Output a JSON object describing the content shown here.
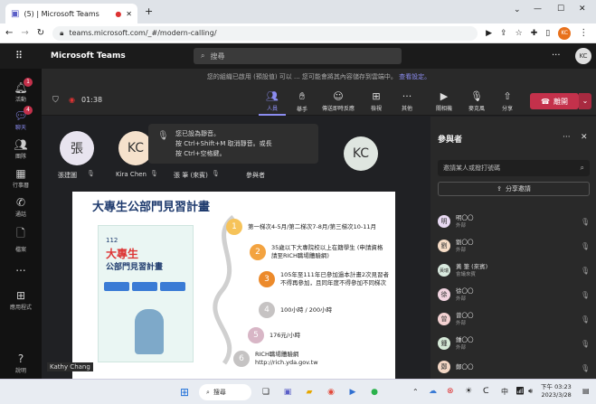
{
  "browser": {
    "tab_count": "(5)",
    "tab_title": "Microsoft Teams",
    "url": "teams.microsoft.com/_#/modern-calling/",
    "profile_initials": "KC"
  },
  "teams": {
    "app_name": "Microsoft Teams",
    "search_placeholder": "搜尋",
    "user_initials": "KC"
  },
  "rail": [
    {
      "label": "活動",
      "icon": "bell-icon",
      "badge": "1"
    },
    {
      "label": "聊天",
      "icon": "chat-icon",
      "badge": "4"
    },
    {
      "label": "團隊",
      "icon": "teams-icon",
      "badge": ""
    },
    {
      "label": "行事曆",
      "icon": "calendar-icon",
      "badge": ""
    },
    {
      "label": "通話",
      "icon": "phone-icon",
      "badge": ""
    },
    {
      "label": "檔案",
      "icon": "file-icon",
      "badge": ""
    },
    {
      "label": "...",
      "icon": "more-icon",
      "badge": ""
    },
    {
      "label": "應用程式",
      "icon": "apps-icon",
      "badge": ""
    },
    {
      "label": "說明",
      "icon": "help-icon",
      "badge": ""
    }
  ],
  "meeting": {
    "notice": "您的組織已啟用 (預設值) 可以 ... 您可能會將其內容儲存到雲端中。",
    "notice_link": "查看設定。",
    "timer": "01:38",
    "controls": [
      {
        "label": "人員",
        "icon": "people-icon"
      },
      {
        "label": "舉手",
        "icon": "hand-icon"
      },
      {
        "label": "傳送即時反應",
        "icon": "emoji-icon"
      },
      {
        "label": "檢視",
        "icon": "view-icon"
      },
      {
        "label": "其他",
        "icon": "more-icon"
      },
      {
        "label": "關相機",
        "icon": "camera-icon"
      },
      {
        "label": "麥克風",
        "icon": "mic-off-icon"
      },
      {
        "label": "分享",
        "icon": "share-icon"
      }
    ],
    "leave_label": "離開"
  },
  "participants_stage": [
    {
      "initials": "張",
      "name": "張建圖",
      "color": "#e8e4ef"
    },
    {
      "initials": "KC",
      "name": "Kira Chen",
      "color": "#f5e1cc"
    },
    {
      "initials": "",
      "name": "張 筆 (來賓)",
      "color": ""
    },
    {
      "initials": "",
      "name": "參與者",
      "color": ""
    },
    {
      "initials": "KC",
      "name": "",
      "color": "#dfe6e0"
    }
  ],
  "toast": {
    "line1": "您已設為靜音。",
    "line2": "按 Ctrl+Shift+M 取消靜音。或長",
    "line3": "按 Ctrl+空格鍵。"
  },
  "slide": {
    "title": "大專生公部門見習計畫",
    "poster_year": "112",
    "poster_title_line1": "大專生",
    "poster_title_line2": "公部門見習計畫",
    "presenter": "Kathy Chang",
    "steps": [
      {
        "n": "1",
        "text": "第一梯次4-5月/第二梯次7-8月/第三梯次10-11月",
        "color": "#f6c35a"
      },
      {
        "n": "2",
        "text": "35歲以下大專院校以上在籍學生 (申請資格請至RICH職場體驗網)",
        "color": "#f3a340"
      },
      {
        "n": "3",
        "text": "105年至111年已參加過本計畫2次見習者不得再參加，且同年度不得參加不同梯次",
        "color": "#ec8a2b"
      },
      {
        "n": "4",
        "text": "100小時 / 200小時",
        "color": "#c6c3c3"
      },
      {
        "n": "5",
        "text": "176元/小時",
        "color": "#d8b6c6"
      },
      {
        "n": "6",
        "text": "RICH職場體驗網 http://rich.yda.gov.tw",
        "color": "#c5c3c3"
      }
    ]
  },
  "panel": {
    "title": "參與者",
    "invite_placeholder": "邀請某人或撥打號碼",
    "share_label": "分享邀請",
    "people": [
      {
        "initials": "明",
        "name": "明〇〇",
        "role": "外部",
        "color": "#e8d9f2"
      },
      {
        "initials": "劉",
        "name": "劉〇〇",
        "role": "外部",
        "color": "#f6dcc6"
      },
      {
        "initials": "黃瑞",
        "name": "黃 筆 (來賓)",
        "role": "會議來賓",
        "color": "#d9eadf"
      },
      {
        "initials": "徐",
        "name": "徐〇〇",
        "role": "外部",
        "color": "#f1d4e0"
      },
      {
        "initials": "曾",
        "name": "曾〇〇",
        "role": "外部",
        "color": "#f4d2d2"
      },
      {
        "initials": "鍾",
        "name": "鍾〇〇",
        "role": "外部",
        "color": "#d6ead8"
      },
      {
        "initials": "鄭",
        "name": "鄭〇〇",
        "role": "",
        "color": "#f3d7c5"
      }
    ]
  },
  "taskbar": {
    "search": "搜尋",
    "time": "下午 03:23",
    "date": "2023/3/28"
  }
}
